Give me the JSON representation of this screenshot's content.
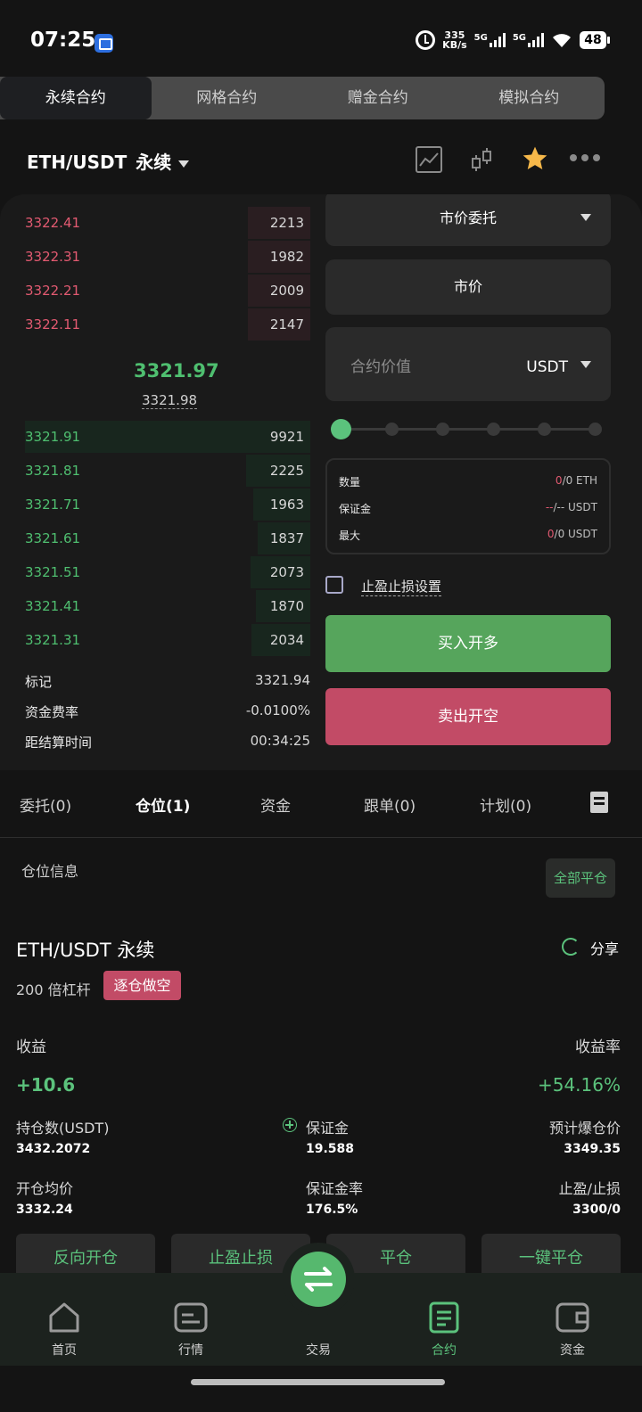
{
  "status": {
    "time": "07:25",
    "speed_value": "335",
    "speed_unit": "KB/s",
    "net1": "5G",
    "net2": "5G",
    "battery": "48"
  },
  "top_tabs": [
    "永续合约",
    "网格合约",
    "赠金合约",
    "模拟合约"
  ],
  "pair": {
    "symbol": "ETH/USDT",
    "type": "永续"
  },
  "orderbook": {
    "asks": [
      {
        "price": "3322.41",
        "qty": "2213",
        "depth": 0.22
      },
      {
        "price": "3322.31",
        "qty": "1982",
        "depth": 0.2
      },
      {
        "price": "3322.21",
        "qty": "2009",
        "depth": 0.21
      },
      {
        "price": "3322.11",
        "qty": "2147",
        "depth": 0.22
      }
    ],
    "last_price": "3321.97",
    "mark_price": "3321.98",
    "bids": [
      {
        "price": "3321.91",
        "qty": "9921",
        "depth": 1.0
      },
      {
        "price": "3321.81",
        "qty": "2225",
        "depth": 0.23
      },
      {
        "price": "3321.71",
        "qty": "1963",
        "depth": 0.2
      },
      {
        "price": "3321.61",
        "qty": "1837",
        "depth": 0.19
      },
      {
        "price": "3321.51",
        "qty": "2073",
        "depth": 0.21
      },
      {
        "price": "3321.41",
        "qty": "1870",
        "depth": 0.19
      },
      {
        "price": "3321.31",
        "qty": "2034",
        "depth": 0.21
      }
    ],
    "stats": [
      {
        "label": "标记",
        "value": "3321.94"
      },
      {
        "label": "资金费率",
        "value": "-0.0100%"
      },
      {
        "label": "距结算时间",
        "value": "00:34:25"
      }
    ]
  },
  "form": {
    "order_type": "市价委托",
    "price_mode": "市价",
    "value_placeholder": "合约价值",
    "value_unit": "USDT",
    "leverage_level": 0,
    "info": {
      "qty_label": "数量",
      "qty_a": "0",
      "qty_b": "/0 ETH",
      "margin_label": "保证金",
      "margin_a": "--",
      "margin_b": "/-- USDT",
      "max_label": "最大",
      "max_a": "0",
      "max_b": "/0 USDT"
    },
    "tp_sl_label": "止盈止损设置",
    "buy_label": "买入开多",
    "sell_label": "卖出开空"
  },
  "section_tabs": [
    "委托(0)",
    "仓位(1)",
    "资金",
    "跟单(0)",
    "计划(0)"
  ],
  "position": {
    "header": "仓位信息",
    "close_all": "全部平仓",
    "title": "ETH/USDT 永续",
    "share": "分享",
    "leverage": "200 倍杠杆",
    "badge": "逐仓做空",
    "pnl_label": "收益",
    "pnl_value": "+10.6",
    "roe_label": "收益率",
    "roe_value": "+54.16%",
    "size_label": "持仓数(USDT)",
    "size_value": "3432.2072",
    "margin_label": "保证金",
    "margin_value": "19.588",
    "liq_label": "预计爆仓价",
    "liq_value": "3349.35",
    "entry_label": "开仓均价",
    "entry_value": "3332.24",
    "margin_ratio_label": "保证金率",
    "margin_ratio_value": "176.5%",
    "tpsl_label": "止盈/止损",
    "tpsl_value": "3300/0",
    "actions": [
      "反向开仓",
      "止盈止损",
      "平仓",
      "一键平仓"
    ]
  },
  "nav": {
    "items": [
      "首页",
      "行情",
      "交易",
      "合约",
      "资金"
    ]
  },
  "colors": {
    "green": "#5bc27c",
    "red": "#c24b66",
    "bg": "#141414"
  }
}
